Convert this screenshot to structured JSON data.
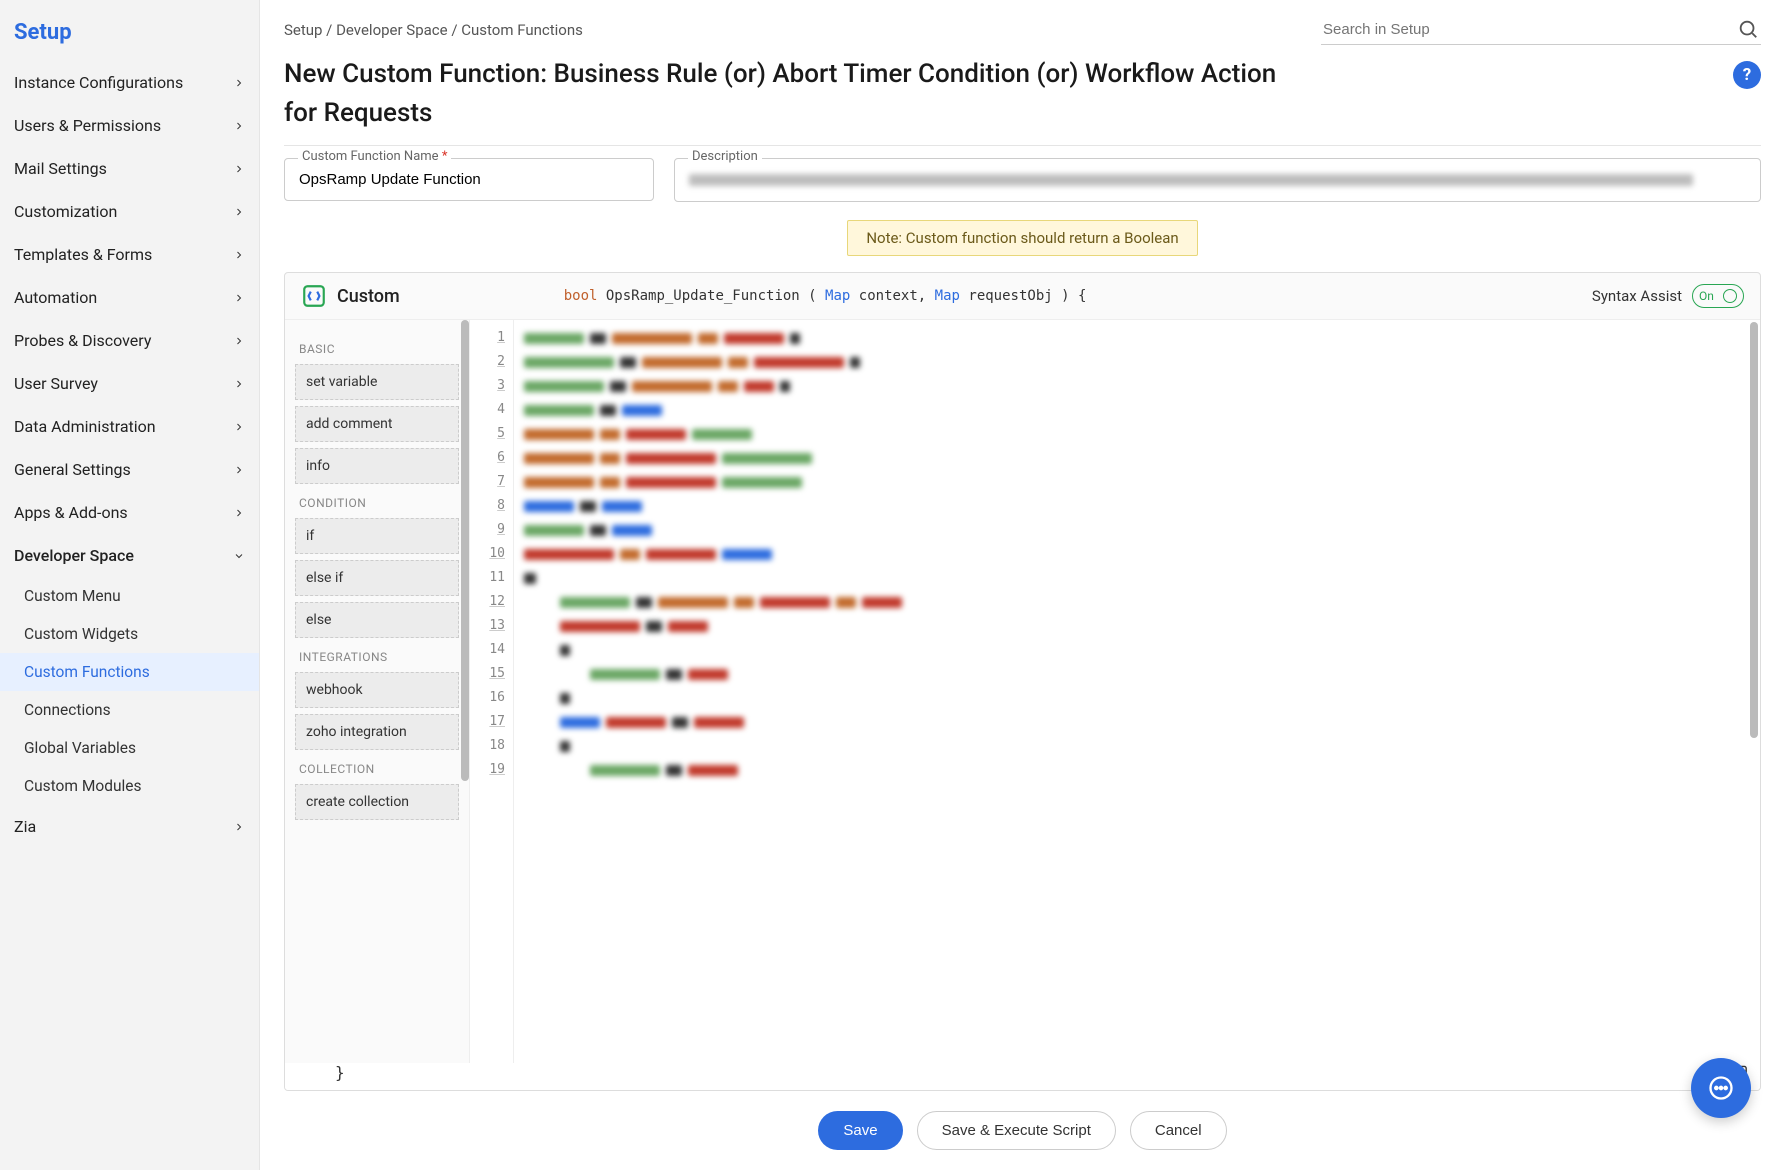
{
  "sidebar": {
    "title": "Setup",
    "items": [
      {
        "label": "Instance Configurations",
        "expandable": true
      },
      {
        "label": "Users & Permissions",
        "expandable": true
      },
      {
        "label": "Mail Settings",
        "expandable": true
      },
      {
        "label": "Customization",
        "expandable": true
      },
      {
        "label": "Templates & Forms",
        "expandable": true
      },
      {
        "label": "Automation",
        "expandable": true
      },
      {
        "label": "Probes & Discovery",
        "expandable": true
      },
      {
        "label": "User Survey",
        "expandable": true
      },
      {
        "label": "Data Administration",
        "expandable": true
      },
      {
        "label": "General Settings",
        "expandable": true
      },
      {
        "label": "Apps & Add-ons",
        "expandable": true
      },
      {
        "label": "Developer Space",
        "expanded": true,
        "expandable": true,
        "children": [
          {
            "label": "Custom Menu"
          },
          {
            "label": "Custom Widgets"
          },
          {
            "label": "Custom Functions",
            "active": true
          },
          {
            "label": "Connections"
          },
          {
            "label": "Global Variables"
          },
          {
            "label": "Custom Modules"
          }
        ]
      },
      {
        "label": "Zia",
        "expandable": true
      }
    ]
  },
  "breadcrumb": "Setup / Developer Space / Custom Functions",
  "search": {
    "placeholder": "Search in Setup"
  },
  "page_title": "New Custom Function: Business Rule (or) Abort Timer Condition (or) Workflow Action for Requests",
  "help_label": "?",
  "fields": {
    "name_label": "Custom Function Name",
    "name_value": "OpsRamp Update Function",
    "desc_label": "Description"
  },
  "note": "Note: Custom function should return a Boolean",
  "editor": {
    "custom_label": "Custom",
    "signature": {
      "ret": "bool",
      "fn": "OpsRamp_Update_Function",
      "p1_type": "Map",
      "p1_name": "context",
      "p2_type": "Map",
      "p2_name": "requestObj"
    },
    "syntax_assist_label": "Syntax Assist",
    "toggle_text": "On",
    "palette": {
      "sections": [
        {
          "title": "BASIC",
          "items": [
            "set variable",
            "add comment",
            "info"
          ]
        },
        {
          "title": "CONDITION",
          "items": [
            "if",
            "else if",
            "else"
          ]
        },
        {
          "title": "INTEGRATIONS",
          "items": [
            "webhook",
            "zoho integration"
          ]
        },
        {
          "title": "COLLECTION",
          "items": [
            "create collection"
          ]
        }
      ]
    },
    "line_count": 19,
    "closing_brace": "}"
  },
  "footer": {
    "save": "Save",
    "save_exec": "Save & Execute Script",
    "cancel": "Cancel"
  },
  "colors": {
    "primary": "#2d6cdf",
    "note_bg": "#fff7db",
    "green": "#29a653"
  }
}
